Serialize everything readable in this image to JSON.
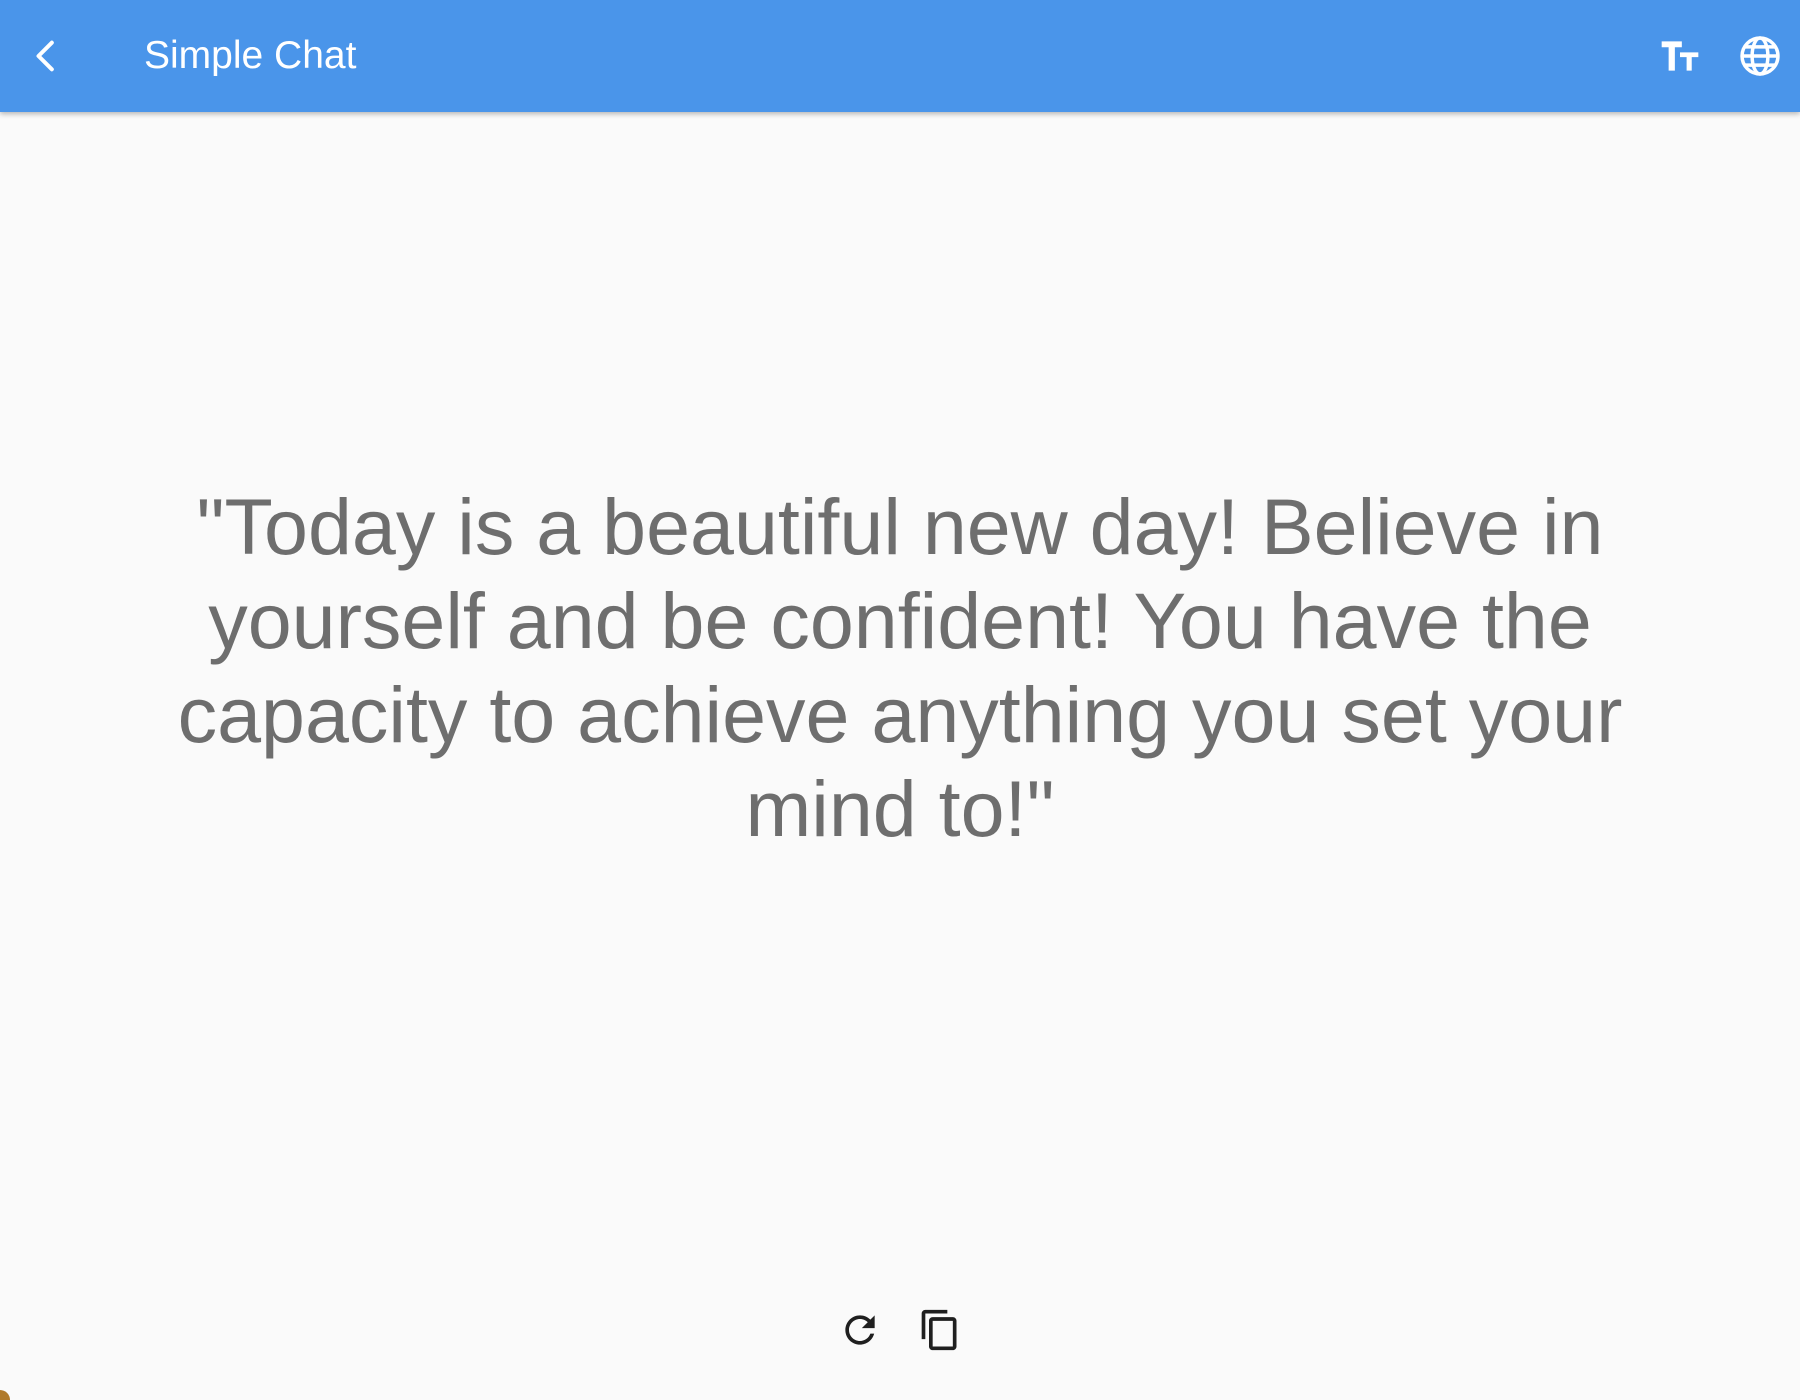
{
  "appbar": {
    "title": "Simple Chat",
    "background_color": "#4a95ea",
    "back_icon": "chevron-left-icon",
    "actions": [
      {
        "id": "text-size",
        "icon": "text-size-icon"
      },
      {
        "id": "language",
        "icon": "globe-icon"
      }
    ]
  },
  "content": {
    "quote_line_1": "\"Today is a beautiful new day! Believe in",
    "quote_line_2": "yourself and be confident! You have the",
    "quote_line_3": "capacity to achieve anything you set your",
    "quote_line_4": "mind to!\"",
    "text_color": "#6e6e6e"
  },
  "bottom_actions": [
    {
      "id": "refresh",
      "icon": "refresh-icon"
    },
    {
      "id": "copy",
      "icon": "copy-icon"
    }
  ]
}
